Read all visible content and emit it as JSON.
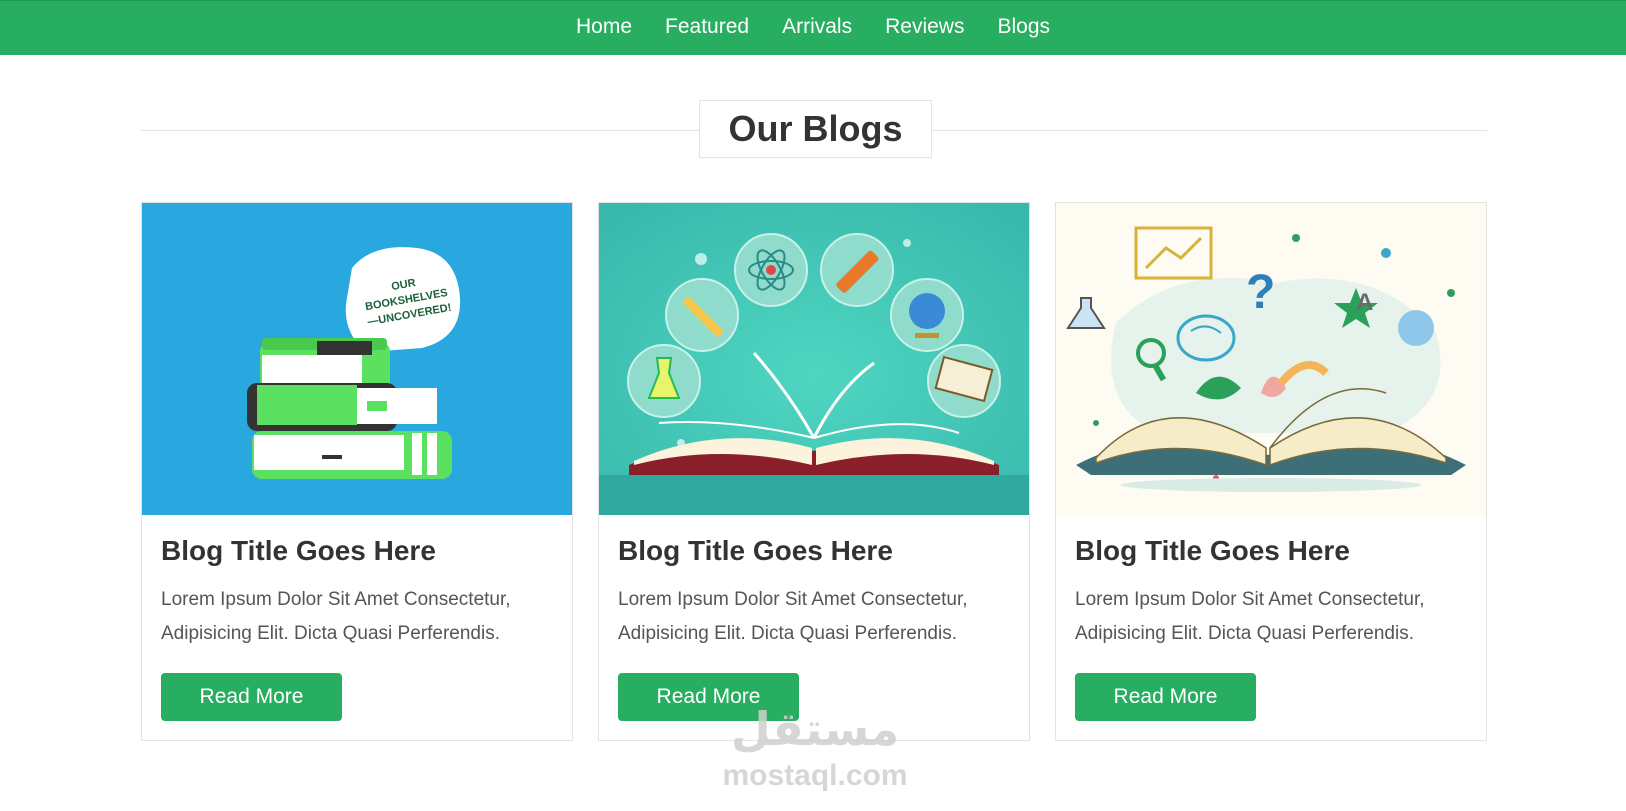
{
  "nav": {
    "items": [
      {
        "label": "Home"
      },
      {
        "label": "Featured"
      },
      {
        "label": "Arrivals"
      },
      {
        "label": "Reviews"
      },
      {
        "label": "Blogs"
      }
    ]
  },
  "section": {
    "title": "Our Blogs"
  },
  "cards": [
    {
      "title": "Blog Title Goes Here",
      "text_line1": "Lorem Ipsum Dolor Sit Amet Consectetur,",
      "text_line2": "Adipisicing Elit. Dicta Quasi Perferendis.",
      "button_label": "Read More",
      "image_text": "OUR BOOKSHELVES —UNCOVERED!"
    },
    {
      "title": "Blog Title Goes Here",
      "text_line1": "Lorem Ipsum Dolor Sit Amet Consectetur,",
      "text_line2": "Adipisicing Elit. Dicta Quasi Perferendis.",
      "button_label": "Read More"
    },
    {
      "title": "Blog Title Goes Here",
      "text_line1": "Lorem Ipsum Dolor Sit Amet Consectetur,",
      "text_line2": "Adipisicing Elit. Dicta Quasi Perferendis.",
      "button_label": "Read More"
    }
  ],
  "watermark": {
    "arabic": "مستقل",
    "latin": "mostaql.com"
  },
  "colors": {
    "accent": "#27ae60",
    "text": "#333333"
  },
  "icons": [
    "books-stack-illustration",
    "education-book-illustration",
    "open-book-doodle-illustration"
  ]
}
